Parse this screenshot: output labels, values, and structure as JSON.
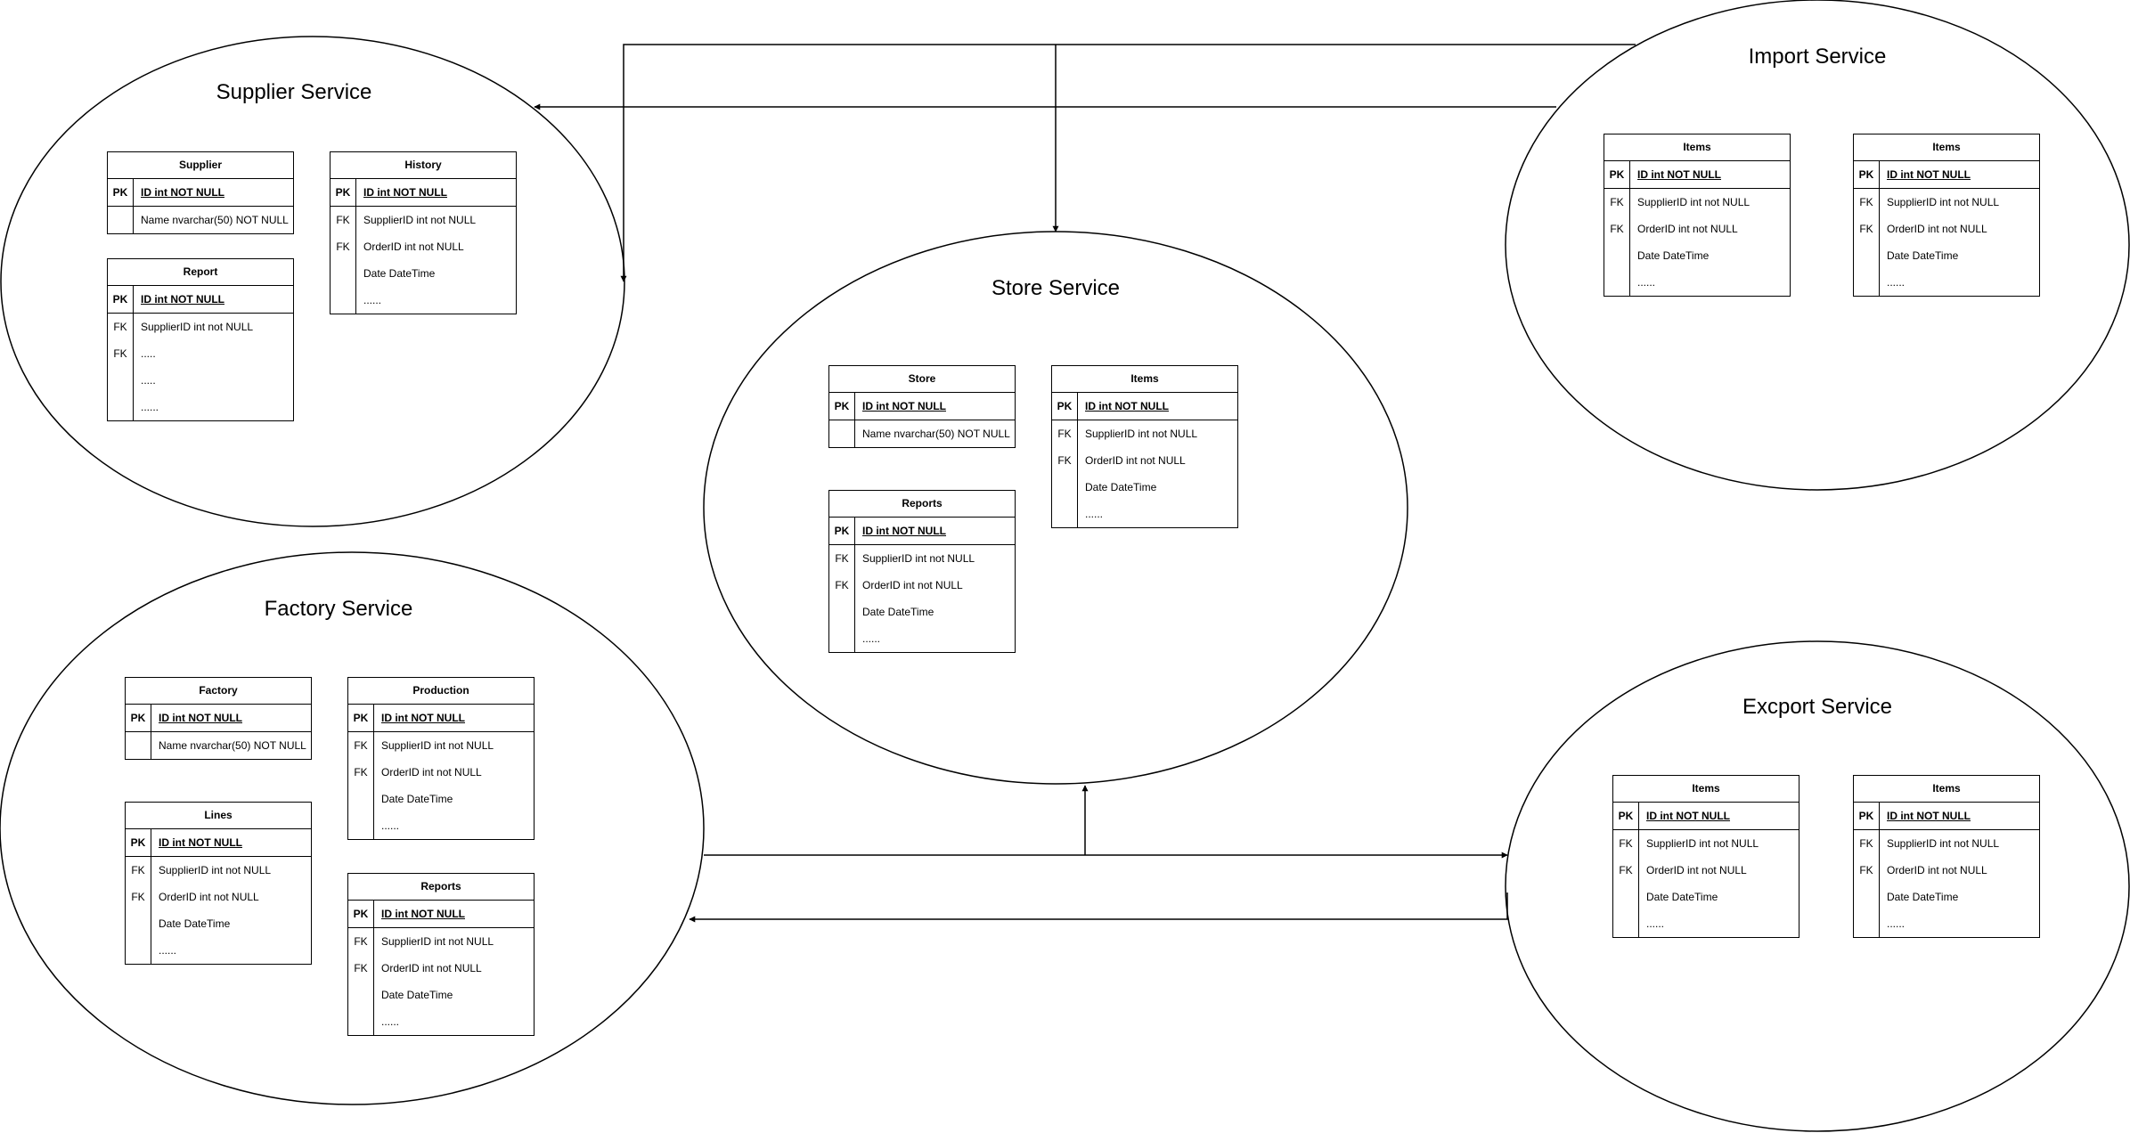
{
  "services": [
    {
      "id": "supplier",
      "title": "Supplier Service",
      "tables": [
        {
          "name": "Supplier",
          "rows": [
            {
              "key": "PK",
              "field": "ID int NOT NULL"
            },
            {
              "key": "",
              "field": "Name nvarchar(50) NOT NULL"
            }
          ]
        },
        {
          "name": "Report",
          "rows": [
            {
              "key": "PK",
              "field": "ID int NOT NULL"
            },
            {
              "key": "FK",
              "field": "SupplierID int not NULL"
            },
            {
              "key": "FK",
              "field": "....."
            },
            {
              "key": "",
              "field": "....."
            },
            {
              "key": "",
              "field": "......"
            }
          ]
        },
        {
          "name": "History",
          "rows": [
            {
              "key": "PK",
              "field": "ID int NOT NULL"
            },
            {
              "key": "FK",
              "field": "SupplierID int not NULL"
            },
            {
              "key": "FK",
              "field": "OrderID int not NULL"
            },
            {
              "key": "",
              "field": "Date DateTime"
            },
            {
              "key": "",
              "field": "......"
            }
          ]
        }
      ]
    },
    {
      "id": "factory",
      "title": "Factory Service",
      "tables": [
        {
          "name": "Factory",
          "rows": [
            {
              "key": "PK",
              "field": "ID int NOT NULL"
            },
            {
              "key": "",
              "field": "Name nvarchar(50) NOT NULL"
            }
          ]
        },
        {
          "name": "Lines",
          "rows": [
            {
              "key": "PK",
              "field": "ID int NOT NULL"
            },
            {
              "key": "FK",
              "field": "SupplierID int not NULL"
            },
            {
              "key": "FK",
              "field": "OrderID int not NULL"
            },
            {
              "key": "",
              "field": "Date DateTime"
            },
            {
              "key": "",
              "field": "......"
            }
          ]
        },
        {
          "name": "Production",
          "rows": [
            {
              "key": "PK",
              "field": "ID int NOT NULL"
            },
            {
              "key": "FK",
              "field": "SupplierID int not NULL"
            },
            {
              "key": "FK",
              "field": "OrderID int not NULL"
            },
            {
              "key": "",
              "field": "Date DateTime"
            },
            {
              "key": "",
              "field": "......"
            }
          ]
        },
        {
          "name": "Reports",
          "rows": [
            {
              "key": "PK",
              "field": "ID int NOT NULL"
            },
            {
              "key": "FK",
              "field": "SupplierID int not NULL"
            },
            {
              "key": "FK",
              "field": "OrderID int not NULL"
            },
            {
              "key": "",
              "field": "Date DateTime"
            },
            {
              "key": "",
              "field": "......"
            }
          ]
        }
      ]
    },
    {
      "id": "store",
      "title": "Store Service",
      "tables": [
        {
          "name": "Store",
          "rows": [
            {
              "key": "PK",
              "field": "ID int NOT NULL"
            },
            {
              "key": "",
              "field": "Name nvarchar(50) NOT NULL"
            }
          ]
        },
        {
          "name": "Reports",
          "rows": [
            {
              "key": "PK",
              "field": "ID int NOT NULL"
            },
            {
              "key": "FK",
              "field": "SupplierID int not NULL"
            },
            {
              "key": "FK",
              "field": "OrderID int not NULL"
            },
            {
              "key": "",
              "field": "Date DateTime"
            },
            {
              "key": "",
              "field": "......"
            }
          ]
        },
        {
          "name": "Items",
          "rows": [
            {
              "key": "PK",
              "field": "ID int NOT NULL"
            },
            {
              "key": "FK",
              "field": "SupplierID int not NULL"
            },
            {
              "key": "FK",
              "field": "OrderID int not NULL"
            },
            {
              "key": "",
              "field": "Date DateTime"
            },
            {
              "key": "",
              "field": "......"
            }
          ]
        }
      ]
    },
    {
      "id": "import",
      "title": "Import Service",
      "tables": [
        {
          "name": "Items",
          "rows": [
            {
              "key": "PK",
              "field": "ID int NOT NULL"
            },
            {
              "key": "FK",
              "field": "SupplierID int not NULL"
            },
            {
              "key": "FK",
              "field": "OrderID int not NULL"
            },
            {
              "key": "",
              "field": "Date DateTime"
            },
            {
              "key": "",
              "field": "......"
            }
          ]
        },
        {
          "name": "Items",
          "rows": [
            {
              "key": "PK",
              "field": "ID int NOT NULL"
            },
            {
              "key": "FK",
              "field": "SupplierID int not NULL"
            },
            {
              "key": "FK",
              "field": "OrderID int not NULL"
            },
            {
              "key": "",
              "field": "Date DateTime"
            },
            {
              "key": "",
              "field": "......"
            }
          ]
        }
      ]
    },
    {
      "id": "export",
      "title": "Excport Service",
      "tables": [
        {
          "name": "Items",
          "rows": [
            {
              "key": "PK",
              "field": "ID int NOT NULL"
            },
            {
              "key": "FK",
              "field": "SupplierID int not NULL"
            },
            {
              "key": "FK",
              "field": "OrderID int not NULL"
            },
            {
              "key": "",
              "field": "Date DateTime"
            },
            {
              "key": "",
              "field": "......"
            }
          ]
        },
        {
          "name": "Items",
          "rows": [
            {
              "key": "PK",
              "field": "ID int NOT NULL"
            },
            {
              "key": "FK",
              "field": "SupplierID int not NULL"
            },
            {
              "key": "FK",
              "field": "OrderID int not NULL"
            },
            {
              "key": "",
              "field": "Date DateTime"
            },
            {
              "key": "",
              "field": "......"
            }
          ]
        }
      ]
    }
  ],
  "connections": [
    {
      "from": "import",
      "to": "supplier"
    },
    {
      "from": "import",
      "to": "store"
    },
    {
      "from": "factory",
      "to": "store"
    },
    {
      "from": "factory",
      "to": "export"
    },
    {
      "from": "export",
      "to": "factory"
    }
  ],
  "colors": {
    "stroke": "#000000",
    "background": "#ffffff"
  }
}
